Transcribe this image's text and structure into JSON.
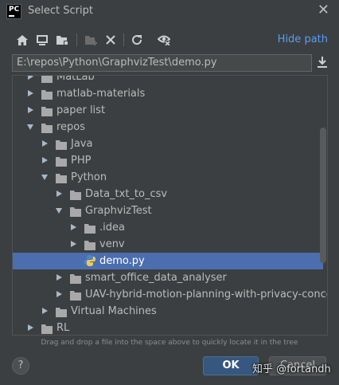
{
  "window": {
    "title": "Select Script",
    "logo_text": "PC",
    "close_glyph": "✕"
  },
  "toolbar": {
    "icons": [
      "home-icon",
      "desktop-icon",
      "project-icon",
      "new-folder-icon",
      "delete-icon",
      "refresh-icon",
      "show-hidden-icon"
    ],
    "hide_path_label": "Hide path"
  },
  "path": {
    "value": "E:\\repos\\Python\\GraphvizTest\\demo.py"
  },
  "tree": {
    "rows": [
      {
        "label": "MatLab",
        "depth": 0,
        "expand": "right",
        "type": "folder"
      },
      {
        "label": "matlab-materials",
        "depth": 0,
        "expand": "right",
        "type": "folder"
      },
      {
        "label": "paper list",
        "depth": 0,
        "expand": "right",
        "type": "folder"
      },
      {
        "label": "repos",
        "depth": 0,
        "expand": "down",
        "type": "folder"
      },
      {
        "label": "Java",
        "depth": 1,
        "expand": "right",
        "type": "folder"
      },
      {
        "label": "PHP",
        "depth": 1,
        "expand": "right",
        "type": "folder"
      },
      {
        "label": "Python",
        "depth": 1,
        "expand": "down",
        "type": "folder"
      },
      {
        "label": "Data_txt_to_csv",
        "depth": 2,
        "expand": "right",
        "type": "folder"
      },
      {
        "label": "GraphvizTest",
        "depth": 2,
        "expand": "down",
        "type": "folder"
      },
      {
        "label": ".idea",
        "depth": 3,
        "expand": "right",
        "type": "folder"
      },
      {
        "label": "venv",
        "depth": 3,
        "expand": "right",
        "type": "folder"
      },
      {
        "label": "demo.py",
        "depth": 3,
        "expand": "none",
        "type": "python",
        "selected": true
      },
      {
        "label": "smart_office_data_analyser",
        "depth": 2,
        "expand": "right",
        "type": "folder"
      },
      {
        "label": "UAV-hybrid-motion-planning-with-privacy-concerr",
        "depth": 2,
        "expand": "right",
        "type": "folder"
      },
      {
        "label": "Virtual Machines",
        "depth": 1,
        "expand": "right",
        "type": "folder"
      },
      {
        "label": "RL",
        "depth": 0,
        "expand": "right",
        "type": "folder"
      }
    ]
  },
  "hint": "Drag and drop a file into the space above to quickly locate it in the tree",
  "buttons": {
    "help": "?",
    "ok": "OK",
    "cancel": "Cancel"
  },
  "watermark": "知乎 @fortandh",
  "colors": {
    "background": "#3c3f41",
    "selection": "#4b6eaf",
    "link": "#589df6",
    "folder": "#a9a9a9",
    "ok_button": "#365880"
  }
}
